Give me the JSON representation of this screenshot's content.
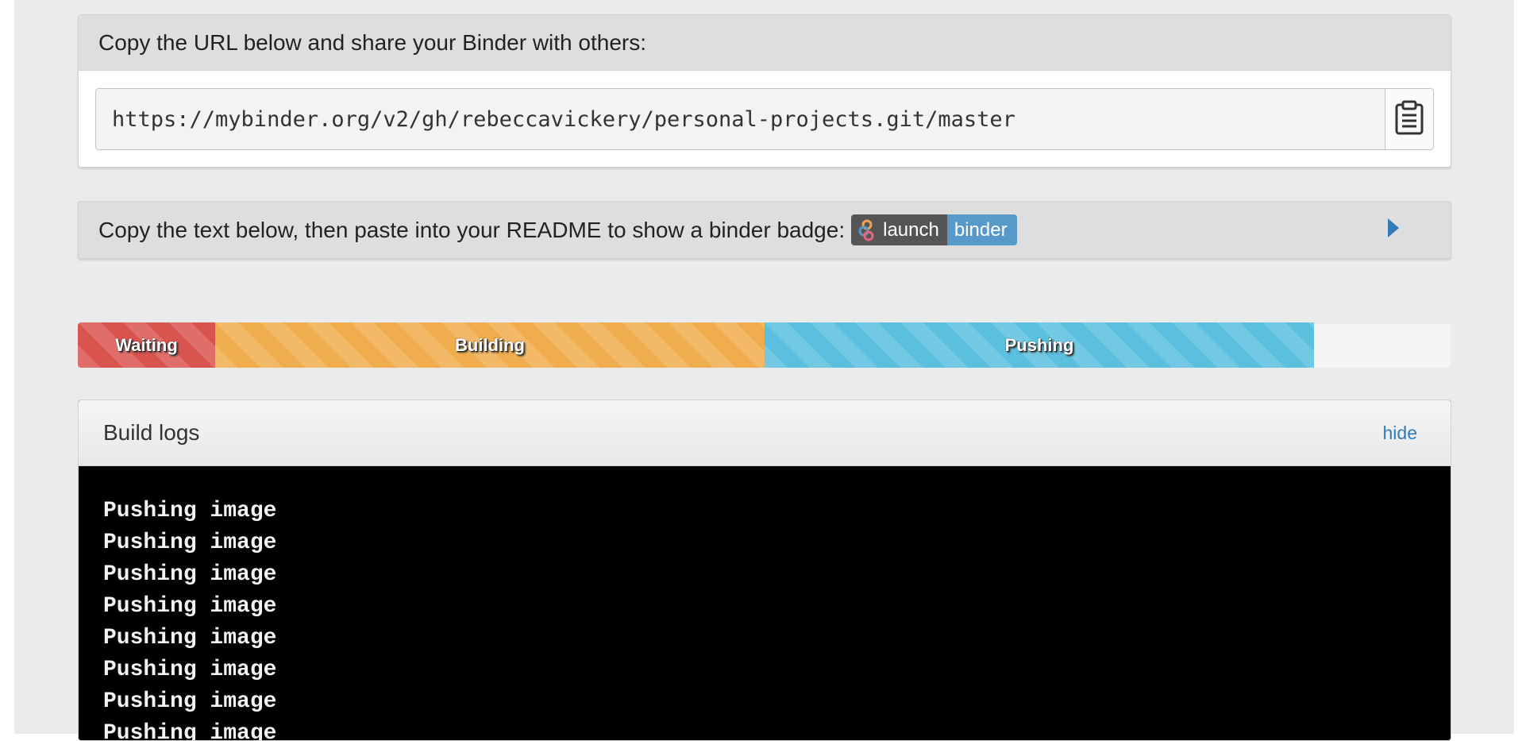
{
  "url_panel": {
    "heading": "Copy the URL below and share your Binder with others:",
    "url": "https://mybinder.org/v2/gh/rebeccavickery/personal-projects.git/master",
    "copy_icon": "clipboard-icon"
  },
  "badge_panel": {
    "text": "Copy the text below, then paste into your README to show a binder badge:",
    "badge_left": "launch",
    "badge_right": "binder",
    "toggle_icon": "caret-right-icon",
    "colors": {
      "badge_left": "#555555",
      "badge_right": "#579aca",
      "toggle": "#337ab7"
    }
  },
  "progress": {
    "steps": [
      {
        "label": "Waiting",
        "fraction": 0.1,
        "color": "#d9534f"
      },
      {
        "label": "Building",
        "fraction": 0.4,
        "color": "#f0ad4e"
      },
      {
        "label": "Pushing",
        "fraction": 0.4,
        "color": "#5bc0de"
      }
    ]
  },
  "logs": {
    "title": "Build logs",
    "hide_label": "hide",
    "lines": [
      "Pushing image",
      "Pushing image",
      "Pushing image",
      "Pushing image",
      "Pushing image",
      "Pushing image",
      "Pushing image",
      "Pushing image"
    ]
  }
}
